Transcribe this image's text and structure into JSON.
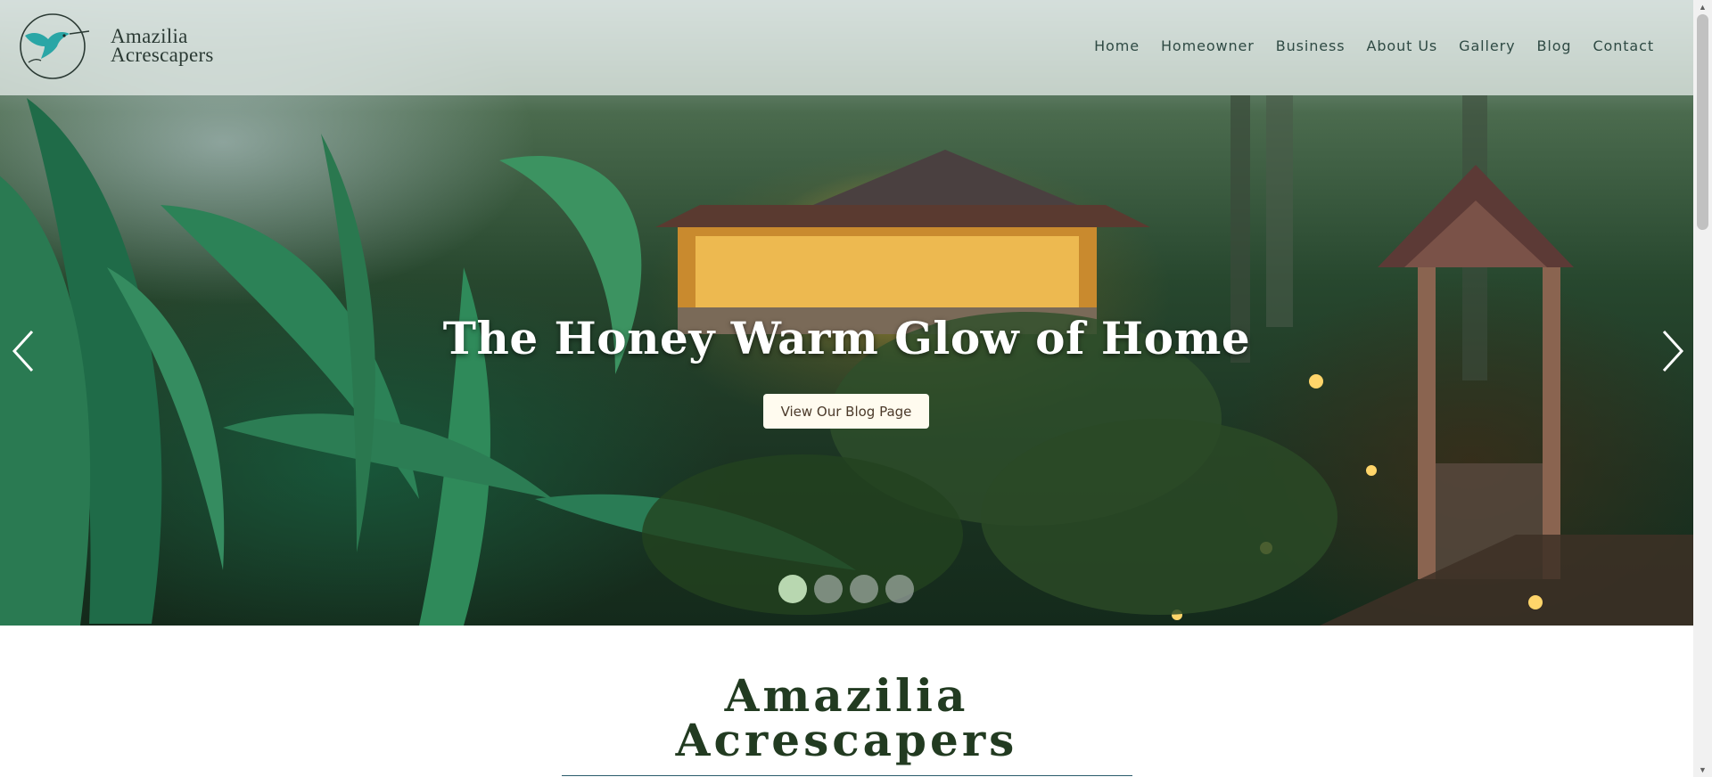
{
  "brand": {
    "line1": "Amazilia",
    "line2": "Acrescapers",
    "logo_icon": "hummingbird-icon"
  },
  "nav": [
    {
      "label": "Home"
    },
    {
      "label": "Homeowner"
    },
    {
      "label": "Business"
    },
    {
      "label": "About Us"
    },
    {
      "label": "Gallery"
    },
    {
      "label": "Blog"
    },
    {
      "label": "Contact"
    }
  ],
  "hero": {
    "title": "The Honey Warm Glow of Home",
    "cta_label": "View Our Blog Page",
    "prev_icon": "chevron-left-icon",
    "next_icon": "chevron-right-icon",
    "slide_count": 4,
    "active_slide": 1
  },
  "section": {
    "title_line1": "Amazilia",
    "title_line2": "Acrescapers"
  },
  "colors": {
    "header_bg": "#e2e9e6",
    "nav_text": "#2f4a44",
    "cta_bg": "#fffbef",
    "dot_active": "#b8d7b0",
    "title_green": "#223b21",
    "logo_teal": "#2aa6a6"
  }
}
